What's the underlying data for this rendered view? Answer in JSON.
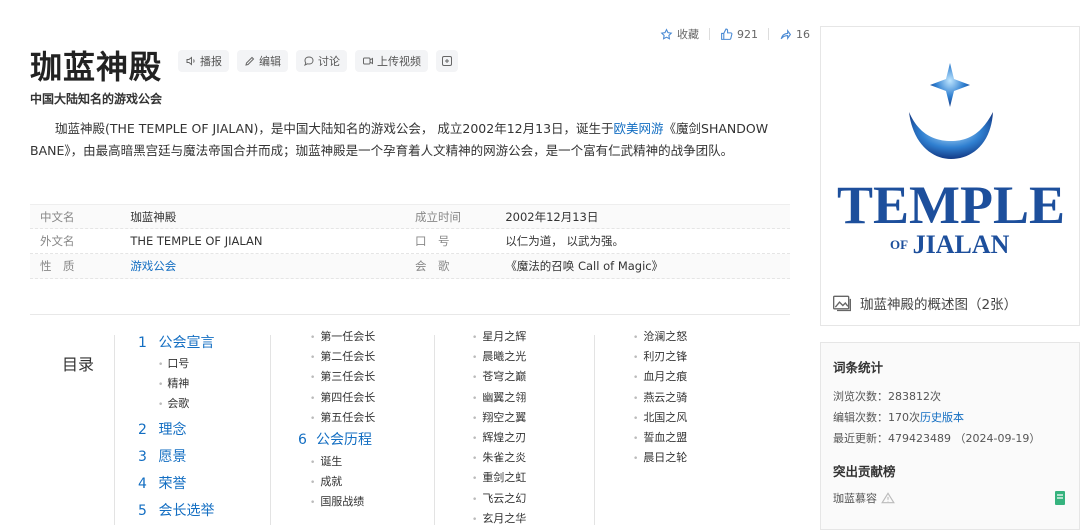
{
  "actions": {
    "collect": "收藏",
    "like_count": "921",
    "share_count": "16"
  },
  "title": "珈蓝神殿",
  "tools": {
    "play": "播报",
    "edit": "编辑",
    "discuss": "讨论",
    "upload": "上传视频"
  },
  "subtitle": "中国大陆知名的游戏公会",
  "summary": {
    "part1": "珈蓝神殿(THE TEMPLE OF JIALAN)，是中国大陆知名的游戏公会， 成立2002年12月13日，诞生于",
    "link": "欧美网游",
    "part2": "《魔剑SHANDOW BANE》，由最高暗黑宫廷与魔法帝国合并而成；珈蓝神殿是一个孕育着人文精神的网游公会，是一个富有仁武精神的战争团队。"
  },
  "info": [
    {
      "k1": "中文名",
      "v1": "珈蓝神殿",
      "k2": "成立时间",
      "v2": "2002年12月13日"
    },
    {
      "k1": "外文名",
      "v1": "THE TEMPLE OF JIALAN",
      "k2": "口　号",
      "v2": "以仁为道， 以武为强。"
    },
    {
      "k1": "性　质",
      "v1": "游戏公会",
      "k2": "会　歌",
      "v2": "《魔法的召唤 Call of Magic》"
    }
  ],
  "catalog": {
    "label": "目录",
    "col1": [
      {
        "type": "h",
        "n": "1",
        "text": "公会宣言"
      },
      {
        "type": "s",
        "text": "口号"
      },
      {
        "type": "s",
        "text": "精神"
      },
      {
        "type": "s",
        "text": "会歌"
      },
      {
        "type": "h",
        "n": "2",
        "text": "理念"
      },
      {
        "type": "h",
        "n": "3",
        "text": "愿景"
      },
      {
        "type": "h",
        "n": "4",
        "text": "荣誉"
      },
      {
        "type": "h",
        "n": "5",
        "text": "会长选举"
      }
    ],
    "col2": [
      {
        "type": "s",
        "text": "第一任会长"
      },
      {
        "type": "s",
        "text": "第二任会长"
      },
      {
        "type": "s",
        "text": "第三任会长"
      },
      {
        "type": "s",
        "text": "第四任会长"
      },
      {
        "type": "s",
        "text": "第五任会长"
      },
      {
        "type": "h",
        "n": "6",
        "text": "公会历程"
      },
      {
        "type": "s",
        "text": "诞生"
      },
      {
        "type": "s",
        "text": "成就"
      },
      {
        "type": "s",
        "text": "国服战绩"
      }
    ],
    "col3": [
      "星月之辉",
      "晨曦之光",
      "苍穹之巅",
      "幽翼之翎",
      "翔空之翼",
      "辉煌之刃",
      "朱雀之炎",
      "重剑之虹",
      "飞云之幻",
      "玄月之华"
    ],
    "col4": [
      "沧澜之怒",
      "利刃之锋",
      "血月之痕",
      "燕云之骑",
      "北国之风",
      "誓血之盟",
      "晨日之轮"
    ]
  },
  "picture": {
    "logo_line1": "TEMPLE",
    "logo_of": "OF",
    "logo_line2": "JIALAN",
    "caption": "珈蓝神殿的概述图（2张）"
  },
  "stats": {
    "heading": "词条统计",
    "views_label": "浏览次数：",
    "views": "283812次",
    "edits_label": "编辑次数：",
    "edits": "170次",
    "history_link": "历史版本",
    "updated_label": "最近更新：",
    "updated_user": "479423489",
    "updated_date": "（2024-09-19）",
    "contrib_heading": "突出贡献榜",
    "contributor": "珈蓝慕容"
  },
  "colors": {
    "link": "#136ec2",
    "logo_blue": "#1d4f9c"
  }
}
